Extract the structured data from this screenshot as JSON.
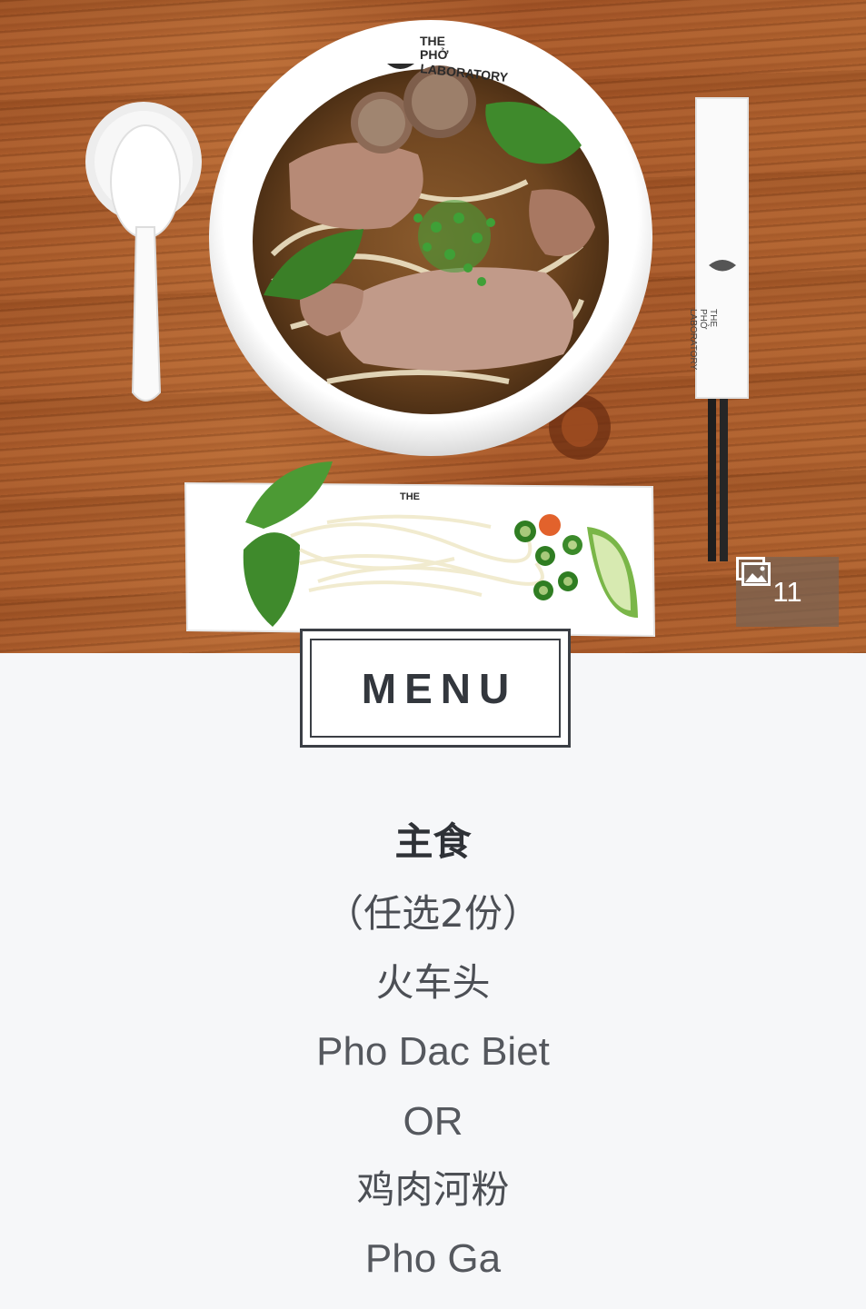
{
  "hero": {
    "bowl_brand_lines": [
      "THE",
      "PHỞ",
      "LABORATORY"
    ],
    "photo_count": "11",
    "gallery_icon": "image-gallery-icon"
  },
  "menu_badge": {
    "label": "MENU"
  },
  "menu": {
    "category": "主食",
    "note": "（任选2份）",
    "items": [
      {
        "text": "火车头"
      },
      {
        "text": "Pho Dac Biet"
      },
      {
        "text": "OR"
      },
      {
        "text": "鸡肉河粉"
      },
      {
        "text": "Pho Ga"
      }
    ]
  },
  "colors": {
    "page_background": "#f6f7f9",
    "badge_border": "#3b3f45",
    "text_primary": "#2f3237",
    "text_secondary": "#4c4f55"
  }
}
